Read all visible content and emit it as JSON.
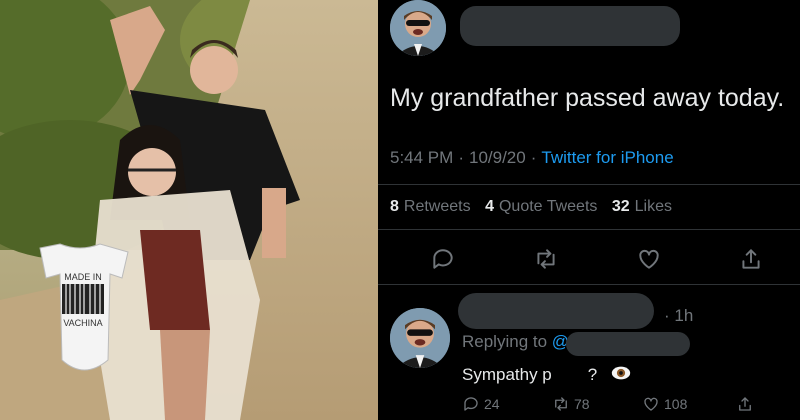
{
  "photo": {
    "onesie_line1": "MADE IN",
    "onesie_line2": "VACHINA"
  },
  "tweet": {
    "text": "My grandfather passed away today.",
    "time": "5:44 PM",
    "date": "10/9/20",
    "source": "Twitter for iPhone",
    "retweets_count": "8",
    "retweets_label": "Retweets",
    "quotes_count": "4",
    "quotes_label": "Quote Tweets",
    "likes_count": "32",
    "likes_label": "Likes",
    "icons": [
      "reply-icon",
      "retweet-icon",
      "like-icon",
      "share-icon"
    ]
  },
  "reply": {
    "time": "· 1h",
    "replying_to": "Replying to",
    "handle_prefix": "@",
    "text_start": "Sympathy p",
    "text_end": "?",
    "reply_count": "24",
    "retweet_count": "78",
    "like_count": "108"
  },
  "colors": {
    "background": "#000000",
    "text": "#e7e9ea",
    "secondary": "#71767b",
    "link": "#1d9bf0",
    "divider": "#2f3336",
    "redaction": "#2f3336"
  }
}
